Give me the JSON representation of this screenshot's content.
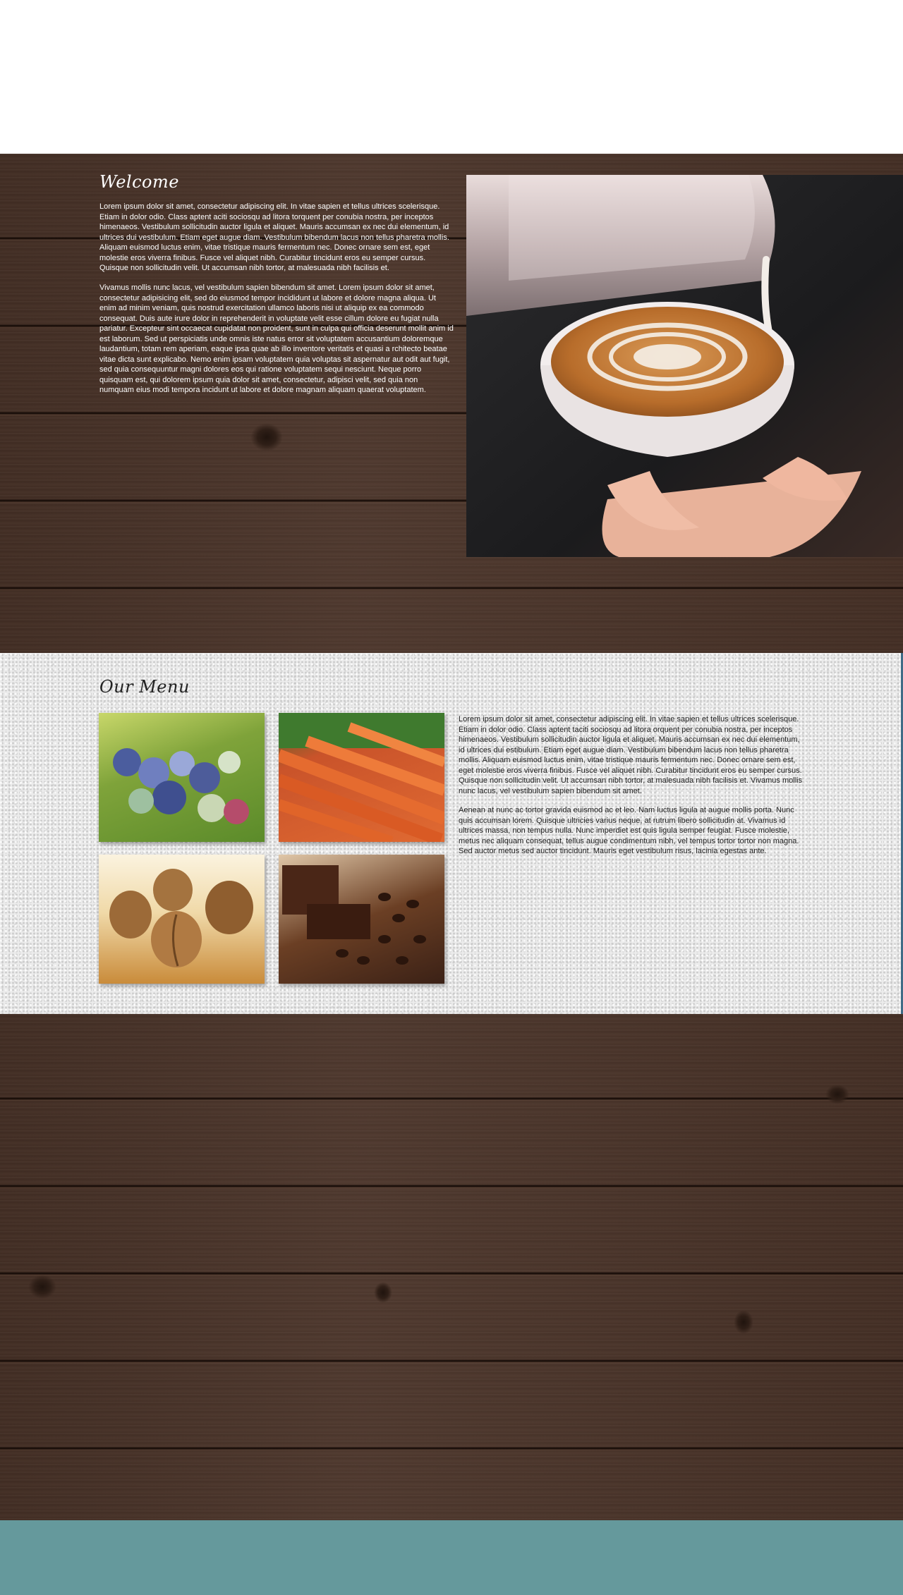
{
  "colors": {
    "wood": "#4a3328",
    "footer": "#65999c",
    "menu_border": "#3f6b86"
  },
  "welcome": {
    "title": "Welcome",
    "paragraph_1": "Lorem ipsum dolor sit amet, consectetur adipiscing elit. In vitae sapien et tellus ultrices scelerisque. Etiam in dolor odio. Class aptent aciti sociosqu ad litora torquent per conubia nostra, per inceptos himenaeos. Vestibulum sollicitudin auctor ligula et aliquet. Mauris accumsan ex nec dui elementum, id ultrices dui vestibulum. Etiam eget augue diam. Vestibulum bibendum lacus non tellus pharetra mollis. Aliquam euismod luctus enim, vitae tristique mauris fermentum nec. Donec ornare sem est, eget molestie eros viverra finibus. Fusce vel aliquet nibh. Curabitur tincidunt eros eu semper cursus. Quisque non sollicitudin velit. Ut accumsan nibh tortor, at malesuada nibh facilisis et.",
    "paragraph_2": "Vivamus mollis nunc lacus, vel vestibulum sapien bibendum sit amet. Lorem ipsum dolor sit amet, consectetur adipisicing elit, sed do eiusmod tempor incididunt ut labore et dolore magna aliqua. Ut enim ad minim veniam, quis nostrud exercitation ullamco laboris nisi ut aliquip ex ea commodo consequat. Duis aute irure dolor in reprehenderit in voluptate velit esse cillum dolore eu fugiat nulla pariatur. Excepteur sint occaecat cupidatat non proident, sunt in culpa qui officia deserunt mollit anim id est laborum. Sed ut perspiciatis unde omnis iste natus error sit voluptatem accusantium doloremque laudantium, totam rem aperiam, eaque ipsa quae ab illo inventore veritatis et quasi a rchitecto beatae vitae dicta sunt explicabo. Nemo enim ipsam voluptatem quia voluptas sit aspernatur aut odit aut fugit, sed quia consequuntur magni dolores eos qui ratione voluptatem sequi nesciunt. Neque porro quisquam est, qui dolorem ipsum quia dolor sit amet, consectetur, adipisci velit, sed quia non numquam eius modi tempora incidunt ut labore et dolore magnam aliquam quaerat voluptatem."
  },
  "menu": {
    "title": "Our Menu",
    "paragraph_1": "Lorem ipsum dolor sit amet, consectetur adipiscing elit. In vitae sapien et tellus ultrices scelerisque. Etiam in dolor odio. Class aptent taciti sociosqu ad litora orquent per conubia nostra, per inceptos himenaeos. Vestibulum sollicitudin auctor ligula et aliquet. Mauris accumsan ex nec dui elementum, id ultrices dui estibulum. Etiam eget augue diam. Vestibulum bibendum lacus non tellus pharetra mollis. Aliquam euismod luctus enim, vitae tristique mauris fermentum nec. Donec ornare sem est, eget molestie eros viverra finibus. Fusce vel aliquet nibh. Curabitur tincidunt eros eu semper cursus. Quisque non sollicitudin velit. Ut accumsan nibh tortor, at malesuada nibh facilisis et. Vivamus mollis nunc lacus, vel vestibulum sapien bibendum sit amet.",
    "paragraph_2": "Aenean at nunc ac tortor gravida euismod ac et leo. Nam luctus ligula at augue mollis porta. Nunc quis accumsan lorem. Quisque ultricies varius neque, at rutrum libero sollicitudin at. Vivamus id ultrices massa, non tempus nulla. Nunc imperdiet est quis ligula semper feugiat. Fusce molestie, metus nec aliquam consequat, tellus augue condimentum nibh, vel tempus tortor tortor non magna. Sed auctor metus sed auctor tincidunt. Mauris eget vestibulum risus, lacinia egestas ante."
  }
}
